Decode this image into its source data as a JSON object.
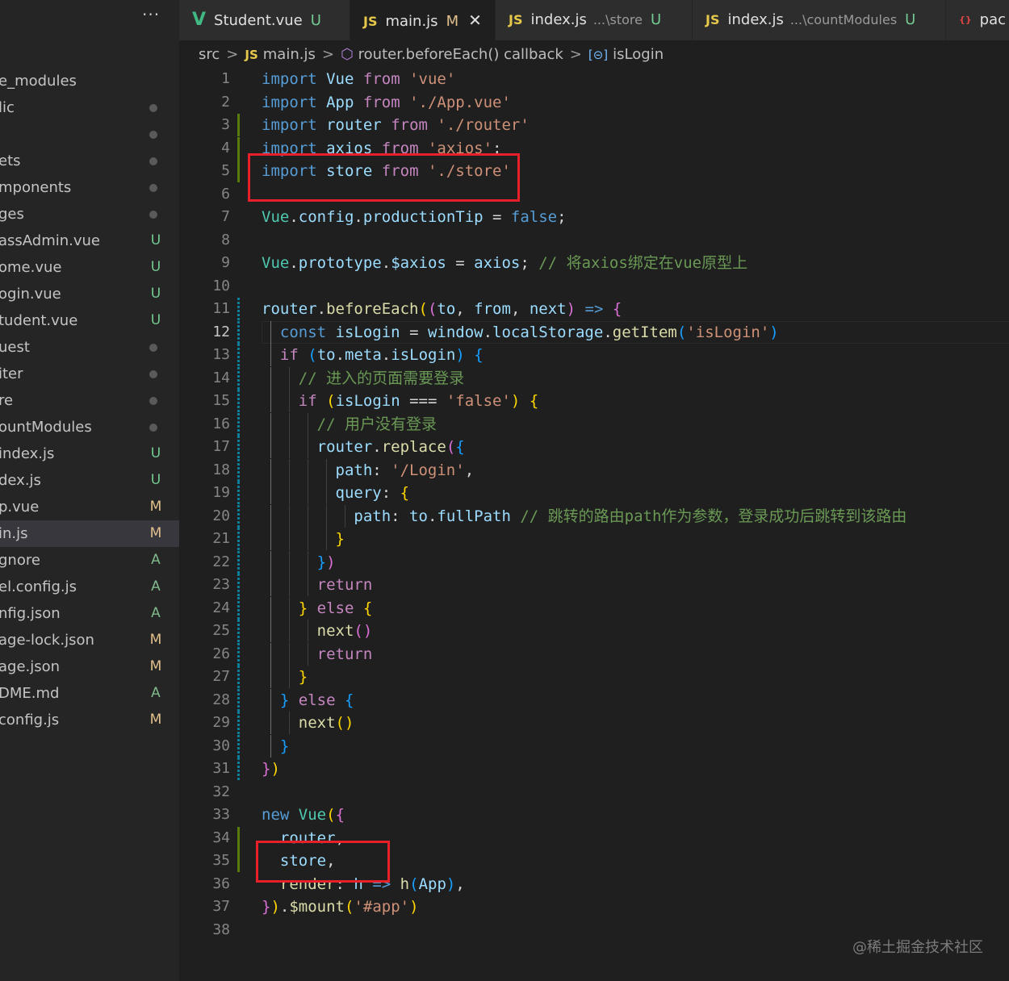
{
  "sidebar": {
    "more_label": "···",
    "files": [
      {
        "name": "e_modules",
        "status": ""
      },
      {
        "name": "lic",
        "status": "dot"
      },
      {
        "name": "",
        "status": "dot"
      },
      {
        "name": "ets",
        "status": "dot"
      },
      {
        "name": "mponents",
        "status": "dot"
      },
      {
        "name": "ges",
        "status": "dot"
      },
      {
        "name": "assAdmin.vue",
        "status": "U"
      },
      {
        "name": "ome.vue",
        "status": "U"
      },
      {
        "name": "ogin.vue",
        "status": "U"
      },
      {
        "name": "tudent.vue",
        "status": "U"
      },
      {
        "name": "uest",
        "status": "dot"
      },
      {
        "name": "iter",
        "status": "dot"
      },
      {
        "name": "re",
        "status": "dot"
      },
      {
        "name": "ountModules",
        "status": "dot"
      },
      {
        "name": "index.js",
        "status": "U"
      },
      {
        "name": "dex.js",
        "status": "U"
      },
      {
        "name": "p.vue",
        "status": "M"
      },
      {
        "name": "in.js",
        "status": "M",
        "selected": true
      },
      {
        "name": "gnore",
        "status": "A"
      },
      {
        "name": "el.config.js",
        "status": "A"
      },
      {
        "name": "nfig.json",
        "status": "A"
      },
      {
        "name": "age-lock.json",
        "status": "M"
      },
      {
        "name": "age.json",
        "status": "M"
      },
      {
        "name": "DME.md",
        "status": "A"
      },
      {
        "name": "config.js",
        "status": "M"
      }
    ]
  },
  "tabs": [
    {
      "icon": "V",
      "icon_type": "vue",
      "name": "Student.vue",
      "desc": "",
      "status": "U",
      "active": false,
      "close": ""
    },
    {
      "icon": "JS",
      "icon_type": "js",
      "name": "main.js",
      "desc": "",
      "status": "M",
      "active": true,
      "close": "✕"
    },
    {
      "icon": "JS",
      "icon_type": "js",
      "name": "index.js",
      "desc": "...\\store",
      "status": "U",
      "active": false,
      "close": ""
    },
    {
      "icon": "JS",
      "icon_type": "js",
      "name": "index.js",
      "desc": "...\\countModules",
      "status": "U",
      "active": false,
      "close": ""
    },
    {
      "icon": "{}",
      "icon_type": "json",
      "name": "pac",
      "desc": "",
      "status": "",
      "active": false,
      "close": ""
    }
  ],
  "breadcrumb": {
    "folder": "src",
    "file_icon": "JS",
    "file": "main.js",
    "symbol_icon": "⬡",
    "symbol": "router.beforeEach() callback",
    "var_icon": "[⊝]",
    "var": "isLogin"
  },
  "editor": {
    "current_line": 12,
    "lines": [
      {
        "n": "1",
        "t": [
          [
            "kw",
            "import"
          ],
          [
            "pl",
            " "
          ],
          [
            "id",
            "Vue"
          ],
          [
            "pl",
            " "
          ],
          [
            "kc",
            "from"
          ],
          [
            "pl",
            " "
          ],
          [
            "str",
            "'vue'"
          ]
        ]
      },
      {
        "n": "2",
        "t": [
          [
            "kw",
            "import"
          ],
          [
            "pl",
            " "
          ],
          [
            "id",
            "App"
          ],
          [
            "pl",
            " "
          ],
          [
            "kc",
            "from"
          ],
          [
            "pl",
            " "
          ],
          [
            "str",
            "'./App.vue'"
          ]
        ]
      },
      {
        "n": "3",
        "t": [
          [
            "kw",
            "import"
          ],
          [
            "pl",
            " "
          ],
          [
            "id",
            "router"
          ],
          [
            "pl",
            " "
          ],
          [
            "kc",
            "from"
          ],
          [
            "pl",
            " "
          ],
          [
            "str",
            "'./router'"
          ]
        ]
      },
      {
        "n": "4",
        "t": [
          [
            "kw",
            "import"
          ],
          [
            "pl",
            " "
          ],
          [
            "id",
            "axios"
          ],
          [
            "pl",
            " "
          ],
          [
            "kc",
            "from"
          ],
          [
            "pl",
            " "
          ],
          [
            "str",
            "'axios'"
          ],
          [
            "pl",
            ";"
          ]
        ]
      },
      {
        "n": "5",
        "t": [
          [
            "kw",
            "import"
          ],
          [
            "pl",
            " "
          ],
          [
            "id",
            "store"
          ],
          [
            "pl",
            " "
          ],
          [
            "kc",
            "from"
          ],
          [
            "pl",
            " "
          ],
          [
            "str",
            "'./store'"
          ]
        ]
      },
      {
        "n": "6",
        "t": []
      },
      {
        "n": "7",
        "t": [
          [
            "cls",
            "Vue"
          ],
          [
            "pl",
            "."
          ],
          [
            "id",
            "config"
          ],
          [
            "pl",
            "."
          ],
          [
            "id",
            "productionTip"
          ],
          [
            "pl",
            " = "
          ],
          [
            "kw",
            "false"
          ],
          [
            "pl",
            ";"
          ]
        ]
      },
      {
        "n": "8",
        "t": []
      },
      {
        "n": "9",
        "t": [
          [
            "cls",
            "Vue"
          ],
          [
            "pl",
            "."
          ],
          [
            "id",
            "prototype"
          ],
          [
            "pl",
            "."
          ],
          [
            "id",
            "$axios"
          ],
          [
            "pl",
            " = "
          ],
          [
            "id",
            "axios"
          ],
          [
            "pl",
            "; "
          ],
          [
            "cm",
            "// 将axios绑定在vue原型上"
          ]
        ]
      },
      {
        "n": "10",
        "t": []
      },
      {
        "n": "11",
        "t": [
          [
            "id",
            "router"
          ],
          [
            "pl",
            "."
          ],
          [
            "fn",
            "beforeEach"
          ],
          [
            "b1",
            "("
          ],
          [
            "b2",
            "("
          ],
          [
            "id",
            "to"
          ],
          [
            "pl",
            ", "
          ],
          [
            "id",
            "from"
          ],
          [
            "pl",
            ", "
          ],
          [
            "id",
            "next"
          ],
          [
            "b2",
            ")"
          ],
          [
            "pl",
            " "
          ],
          [
            "kw",
            "=>"
          ],
          [
            "pl",
            " "
          ],
          [
            "b2",
            "{"
          ]
        ]
      },
      {
        "n": "12",
        "t": [
          [
            "pl",
            "  "
          ],
          [
            "kw",
            "const"
          ],
          [
            "pl",
            " "
          ],
          [
            "id",
            "isLogin"
          ],
          [
            "pl",
            " = "
          ],
          [
            "id",
            "window"
          ],
          [
            "pl",
            "."
          ],
          [
            "id",
            "localStorage"
          ],
          [
            "pl",
            "."
          ],
          [
            "fn",
            "getItem"
          ],
          [
            "b3",
            "("
          ],
          [
            "str",
            "'isLogin'"
          ],
          [
            "b3",
            ")"
          ]
        ]
      },
      {
        "n": "13",
        "t": [
          [
            "pl",
            "  "
          ],
          [
            "kc",
            "if"
          ],
          [
            "pl",
            " "
          ],
          [
            "b3",
            "("
          ],
          [
            "id",
            "to"
          ],
          [
            "pl",
            "."
          ],
          [
            "id",
            "meta"
          ],
          [
            "pl",
            "."
          ],
          [
            "id",
            "isLogin"
          ],
          [
            "b3",
            ")"
          ],
          [
            "pl",
            " "
          ],
          [
            "b3",
            "{"
          ]
        ]
      },
      {
        "n": "14",
        "t": [
          [
            "pl",
            "    "
          ],
          [
            "cm",
            "// 进入的页面需要登录"
          ]
        ]
      },
      {
        "n": "15",
        "t": [
          [
            "pl",
            "    "
          ],
          [
            "kc",
            "if"
          ],
          [
            "pl",
            " "
          ],
          [
            "b1",
            "("
          ],
          [
            "id",
            "isLogin"
          ],
          [
            "pl",
            " === "
          ],
          [
            "str",
            "'false'"
          ],
          [
            "b1",
            ")"
          ],
          [
            "pl",
            " "
          ],
          [
            "b1",
            "{"
          ]
        ]
      },
      {
        "n": "16",
        "t": [
          [
            "pl",
            "      "
          ],
          [
            "cm",
            "// 用户没有登录"
          ]
        ]
      },
      {
        "n": "17",
        "t": [
          [
            "pl",
            "      "
          ],
          [
            "id",
            "router"
          ],
          [
            "pl",
            "."
          ],
          [
            "fn",
            "replace"
          ],
          [
            "b2",
            "("
          ],
          [
            "b3",
            "{"
          ]
        ]
      },
      {
        "n": "18",
        "t": [
          [
            "pl",
            "        "
          ],
          [
            "id",
            "path"
          ],
          [
            "pl",
            ": "
          ],
          [
            "str",
            "'/Login'"
          ],
          [
            "pl",
            ","
          ]
        ]
      },
      {
        "n": "19",
        "t": [
          [
            "pl",
            "        "
          ],
          [
            "id",
            "query"
          ],
          [
            "pl",
            ": "
          ],
          [
            "b1",
            "{"
          ]
        ]
      },
      {
        "n": "20",
        "t": [
          [
            "pl",
            "          "
          ],
          [
            "id",
            "path"
          ],
          [
            "pl",
            ": "
          ],
          [
            "id",
            "to"
          ],
          [
            "pl",
            "."
          ],
          [
            "id",
            "fullPath"
          ],
          [
            "pl",
            " "
          ],
          [
            "cm",
            "// 跳转的路由path作为参数，登录成功后跳转到该路由"
          ]
        ]
      },
      {
        "n": "21",
        "t": [
          [
            "pl",
            "        "
          ],
          [
            "b1",
            "}"
          ]
        ]
      },
      {
        "n": "22",
        "t": [
          [
            "pl",
            "      "
          ],
          [
            "b3",
            "}"
          ],
          [
            "b2",
            ")"
          ]
        ]
      },
      {
        "n": "23",
        "t": [
          [
            "pl",
            "      "
          ],
          [
            "kc",
            "return"
          ]
        ]
      },
      {
        "n": "24",
        "t": [
          [
            "pl",
            "    "
          ],
          [
            "b1",
            "}"
          ],
          [
            "pl",
            " "
          ],
          [
            "kc",
            "else"
          ],
          [
            "pl",
            " "
          ],
          [
            "b1",
            "{"
          ]
        ]
      },
      {
        "n": "25",
        "t": [
          [
            "pl",
            "      "
          ],
          [
            "fn",
            "next"
          ],
          [
            "b2",
            "()"
          ]
        ]
      },
      {
        "n": "26",
        "t": [
          [
            "pl",
            "      "
          ],
          [
            "kc",
            "return"
          ]
        ]
      },
      {
        "n": "27",
        "t": [
          [
            "pl",
            "    "
          ],
          [
            "b1",
            "}"
          ]
        ]
      },
      {
        "n": "28",
        "t": [
          [
            "pl",
            "  "
          ],
          [
            "b3",
            "}"
          ],
          [
            "pl",
            " "
          ],
          [
            "kc",
            "else"
          ],
          [
            "pl",
            " "
          ],
          [
            "b3",
            "{"
          ]
        ]
      },
      {
        "n": "29",
        "t": [
          [
            "pl",
            "    "
          ],
          [
            "fn",
            "next"
          ],
          [
            "b1",
            "()"
          ]
        ]
      },
      {
        "n": "30",
        "t": [
          [
            "pl",
            "  "
          ],
          [
            "b3",
            "}"
          ]
        ]
      },
      {
        "n": "31",
        "t": [
          [
            "b2",
            "}"
          ],
          [
            "b1",
            ")"
          ]
        ]
      },
      {
        "n": "32",
        "t": []
      },
      {
        "n": "33",
        "t": [
          [
            "kw",
            "new"
          ],
          [
            "pl",
            " "
          ],
          [
            "cls",
            "Vue"
          ],
          [
            "b1",
            "("
          ],
          [
            "b2",
            "{"
          ]
        ]
      },
      {
        "n": "34",
        "t": [
          [
            "pl",
            "  "
          ],
          [
            "id",
            "router"
          ],
          [
            "pl",
            ","
          ]
        ]
      },
      {
        "n": "35",
        "t": [
          [
            "pl",
            "  "
          ],
          [
            "id",
            "store"
          ],
          [
            "pl",
            ","
          ]
        ]
      },
      {
        "n": "36",
        "t": [
          [
            "pl",
            "  "
          ],
          [
            "fn",
            "render"
          ],
          [
            "pl",
            ": "
          ],
          [
            "id",
            "h"
          ],
          [
            "pl",
            " "
          ],
          [
            "kw",
            "=>"
          ],
          [
            "pl",
            " "
          ],
          [
            "fn",
            "h"
          ],
          [
            "b3",
            "("
          ],
          [
            "id",
            "App"
          ],
          [
            "b3",
            ")"
          ],
          [
            "pl",
            ","
          ]
        ]
      },
      {
        "n": "37",
        "t": [
          [
            "b2",
            "}"
          ],
          [
            "b1",
            ")"
          ],
          [
            "pl",
            "."
          ],
          [
            "fn",
            "$mount"
          ],
          [
            "b1",
            "("
          ],
          [
            "str",
            "'#app'"
          ],
          [
            "b1",
            ")"
          ]
        ]
      },
      {
        "n": "38",
        "t": []
      }
    ]
  },
  "watermark": "@稀土掘金技术社区"
}
